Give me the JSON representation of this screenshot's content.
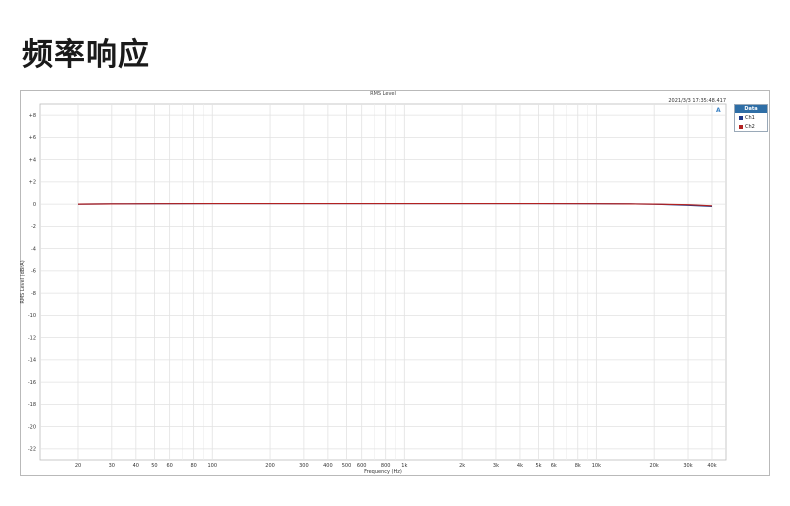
{
  "page": {
    "title": "频率响应"
  },
  "chart_data": {
    "type": "line",
    "title": "RMS Level",
    "timestamp": "2021/3/3 17:35:48.417",
    "xlabel": "Frequency (Hz)",
    "ylabel": "RMS Level (dBrA)",
    "xscale": "log",
    "xlim": [
      20,
      40000
    ],
    "ylim": [
      -23,
      9
    ],
    "grid": true,
    "legend": {
      "title": "Data",
      "placement": "top-right"
    },
    "x_ticks": [
      {
        "v": 20,
        "label": "20"
      },
      {
        "v": 30,
        "label": "30"
      },
      {
        "v": 40,
        "label": "40"
      },
      {
        "v": 50,
        "label": "50"
      },
      {
        "v": 60,
        "label": "60"
      },
      {
        "v": 80,
        "label": "80"
      },
      {
        "v": 100,
        "label": "100"
      },
      {
        "v": 200,
        "label": "200"
      },
      {
        "v": 300,
        "label": "300"
      },
      {
        "v": 400,
        "label": "400"
      },
      {
        "v": 500,
        "label": "500"
      },
      {
        "v": 600,
        "label": "600"
      },
      {
        "v": 800,
        "label": "800"
      },
      {
        "v": 1000,
        "label": "1k"
      },
      {
        "v": 2000,
        "label": "2k"
      },
      {
        "v": 3000,
        "label": "3k"
      },
      {
        "v": 4000,
        "label": "4k"
      },
      {
        "v": 5000,
        "label": "5k"
      },
      {
        "v": 6000,
        "label": "6k"
      },
      {
        "v": 8000,
        "label": "8k"
      },
      {
        "v": 10000,
        "label": "10k"
      },
      {
        "v": 20000,
        "label": "20k"
      },
      {
        "v": 30000,
        "label": "30k"
      },
      {
        "v": 40000,
        "label": "40k"
      }
    ],
    "x_minor_grid": [
      70,
      90,
      700,
      900,
      7000,
      9000
    ],
    "y_ticks": [
      {
        "v": 8,
        "label": "+8"
      },
      {
        "v": 6,
        "label": "+6"
      },
      {
        "v": 4,
        "label": "+4"
      },
      {
        "v": 2,
        "label": "+2"
      },
      {
        "v": 0,
        "label": "0"
      },
      {
        "v": -2,
        "label": "-2"
      },
      {
        "v": -4,
        "label": "-4"
      },
      {
        "v": -6,
        "label": "-6"
      },
      {
        "v": -8,
        "label": "-8"
      },
      {
        "v": -10,
        "label": "-10"
      },
      {
        "v": -12,
        "label": "-12"
      },
      {
        "v": -14,
        "label": "-14"
      },
      {
        "v": -16,
        "label": "-16"
      },
      {
        "v": -18,
        "label": "-18"
      },
      {
        "v": -20,
        "label": "-20"
      },
      {
        "v": -22,
        "label": "-22"
      }
    ],
    "series": [
      {
        "name": "Ch1",
        "color": "#1f3a8a",
        "x": [
          20,
          30,
          50,
          100,
          200,
          500,
          1000,
          2000,
          5000,
          10000,
          15000,
          20000,
          30000,
          40000
        ],
        "y": [
          0,
          0.02,
          0.04,
          0.05,
          0.05,
          0.05,
          0.05,
          0.05,
          0.05,
          0.04,
          0.02,
          0,
          -0.1,
          -0.2
        ]
      },
      {
        "name": "Ch2",
        "color": "#b22222",
        "x": [
          20,
          30,
          50,
          100,
          200,
          500,
          1000,
          2000,
          5000,
          10000,
          15000,
          20000,
          30000,
          40000
        ],
        "y": [
          0,
          0.02,
          0.04,
          0.05,
          0.05,
          0.05,
          0.05,
          0.05,
          0.05,
          0.04,
          0.02,
          0,
          -0.05,
          -0.15
        ]
      }
    ]
  }
}
